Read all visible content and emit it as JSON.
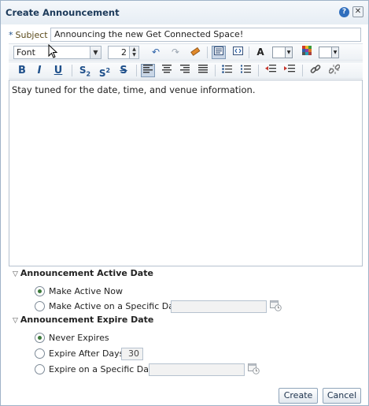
{
  "dialog": {
    "title": "Create Announcement",
    "help_icon": "?",
    "close_icon": "✕"
  },
  "subject": {
    "required_mark": "*",
    "label": "Subject",
    "value": "Announcing the new Get Connected Space!"
  },
  "toolbar": {
    "font_select": "Font",
    "font_size": "2",
    "icons_row1": [
      "undo-icon",
      "redo-icon",
      "eraser-icon",
      "rich-text-mode-icon",
      "source-mode-icon",
      "text-color-icon",
      "background-color-icon"
    ],
    "icons_row2": [
      "bold-icon",
      "italic-icon",
      "underline-icon",
      "subscript-icon",
      "superscript-icon",
      "strikethrough-icon",
      "align-left-icon",
      "align-center-icon",
      "align-right-icon",
      "justify-icon",
      "bullet-list-icon",
      "numbered-list-icon",
      "outdent-icon",
      "indent-icon",
      "link-icon",
      "unlink-icon"
    ],
    "bold": "B",
    "italic": "I",
    "underline": "U",
    "subscript": "S",
    "subscript_mark": "2",
    "superscript": "S",
    "superscript_mark": "2",
    "strike": "S"
  },
  "editor": {
    "content": "Stay tuned for the date, time, and venue information."
  },
  "active_date": {
    "heading": "Announcement Active Date",
    "options": [
      {
        "label": "Make Active Now",
        "selected": true
      },
      {
        "label": "Make Active on a Specific Date",
        "selected": false
      }
    ],
    "date_value": ""
  },
  "expire_date": {
    "heading": "Announcement Expire Date",
    "options": [
      {
        "label": "Never Expires",
        "selected": true
      },
      {
        "label": "Expire After Days",
        "selected": false
      },
      {
        "label": "Expire on a Specific Date",
        "selected": false
      }
    ],
    "days_value": "30",
    "date_value": ""
  },
  "buttons": {
    "create": "Create",
    "cancel": "Cancel"
  },
  "colors": {
    "accent": "#2f6ebd",
    "title_text": "#1c3a5a",
    "radio_selected": "#3c7a3a"
  }
}
